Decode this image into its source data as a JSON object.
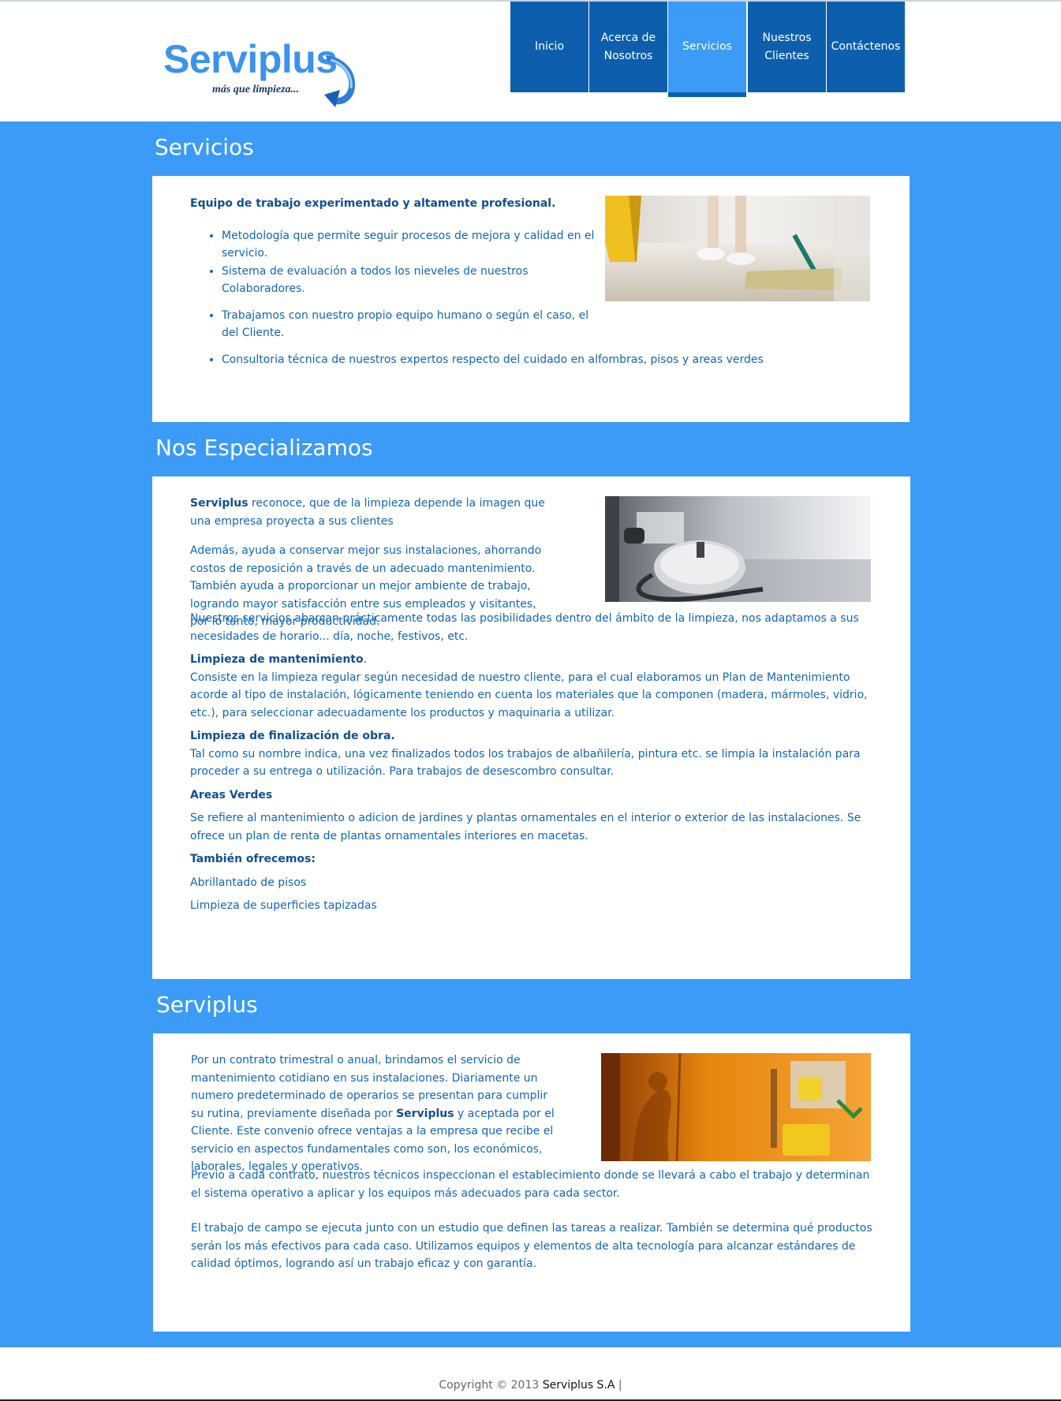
{
  "brand": {
    "name": "Serviplus",
    "tagline": "más que limpieza...",
    "accent": "#3b9bf6",
    "nav_color": "#0d5fae",
    "text_color": "#1066b6"
  },
  "nav": [
    {
      "label": "Inicio",
      "active": false
    },
    {
      "label": "Acerca de Nosotros",
      "active": false
    },
    {
      "label": "Servicios",
      "active": true
    },
    {
      "label": "Nuestros Clientes",
      "active": false
    },
    {
      "label": "Contáctenos",
      "active": false
    }
  ],
  "servicios": {
    "title": "Servicios",
    "lead": "Equipo de trabajo experimentado y altamente profesional.",
    "bullets": [
      "Metodología que permite seguir procesos de mejora y calidad en el servicio.",
      "Sistema de evaluación a todos los nieveles de nuestros Colaboradores.",
      "Trabajamos con nuestro propio equipo humano o según el caso, el del Cliente.",
      "Consultoria técnica de nuestros expertos respecto del cuidado en alfombras, pisos y areas verdes"
    ],
    "image": "mopping-floor-photo"
  },
  "especializamos": {
    "title": "Nos Especializamos",
    "intro_brand": "Serviplus",
    "intro_rest": " reconoce, que de la limpieza depende la imagen que una empresa proyecta a sus clientes",
    "p2": "Además, ayuda a conservar mejor sus instalaciones, ahorrando costos de reposición a través de un adecuado mantenimiento. También ayuda a proporcionar un mejor ambiente de trabajo, logrando mayor satisfacción entre sus empleados y visitantes, por lo tanto, mayor productividad.",
    "p3": "Nuestros servicios abarcan prácticamente todas las posibilidades dentro del ámbito de la limpieza, nos adaptamos a sus necesidades de horario... día, noche, festivos, etc.",
    "h_mant": "Limpieza de mantenimiento",
    "h_mant_dot": ".",
    "p_mant": "Consiste en la limpieza regular según necesidad de nuestro cliente, para el cual elaboramos un Plan de Mantenimiento acorde al tipo de instalación, lógicamente teniendo en cuenta los materiales que la componen (madera, mármoles, vidrio,  etc.), para seleccionar adecuadamente los productos y maquinaria a utilizar.",
    "h_obra": "Limpieza de finalización de obra.",
    "p_obra": "Tal como su nombre indica, una vez finalizados todos los trabajos de albañilería, pintura etc. se limpia la instalación para proceder a su entrega o utilización. Para trabajos de desescombro consultar.",
    "h_verdes": "Areas Verdes",
    "p_verdes": "Se refiere al mantenimiento o adicion de jardines y plantas ornamentales en el interior o exterior de las instalaciones. Se ofrece un plan de renta de plantas ornamentales interiores en macetas.",
    "h_tambien": "También ofrecemos:",
    "extra1": "Abrillantado de pisos",
    "extra2": "Limpieza de superficies tapizadas",
    "image": "vacuum-cleaner-photo"
  },
  "serviplus": {
    "title": "Serviplus",
    "p1a": "Por un contrato trimestral o anual, brindamos el servicio  de mantenimiento cotidiano en sus instalaciones. Diariamente un numero predeterminado de operarios se presentan para cumplir su rutina, previamente diseñada por ",
    "p1_brand": "Serviplus",
    "p1b": " y aceptada por el Cliente. Este convenio ofrece ventajas a la empresa que recibe el servicio en aspectos fundamentales como son, los económicos, laborales, legales y operativos.",
    "p2": "Previo a cada contrato, nuestros técnicos inspeccionan  el establecimiento donde se llevará a cabo el trabajo y determinan el sistema operativo a aplicar y los equipos más adecuados para cada sector.",
    "p3": "El trabajo de campo se ejecuta junto con un estudio que definen las tareas a realizar. También se determina qué productos serán los más efectivos para cada caso. Utilizamos equipos y elementos de alta tecnología para alcanzar estándares de calidad óptimos, logrando así un trabajo eficaz y con garantía.",
    "image": "janitor-cart-photo"
  },
  "footer": {
    "copyright": "Copyright © 2013 ",
    "company": "Serviplus S.A",
    "sep": " |"
  }
}
